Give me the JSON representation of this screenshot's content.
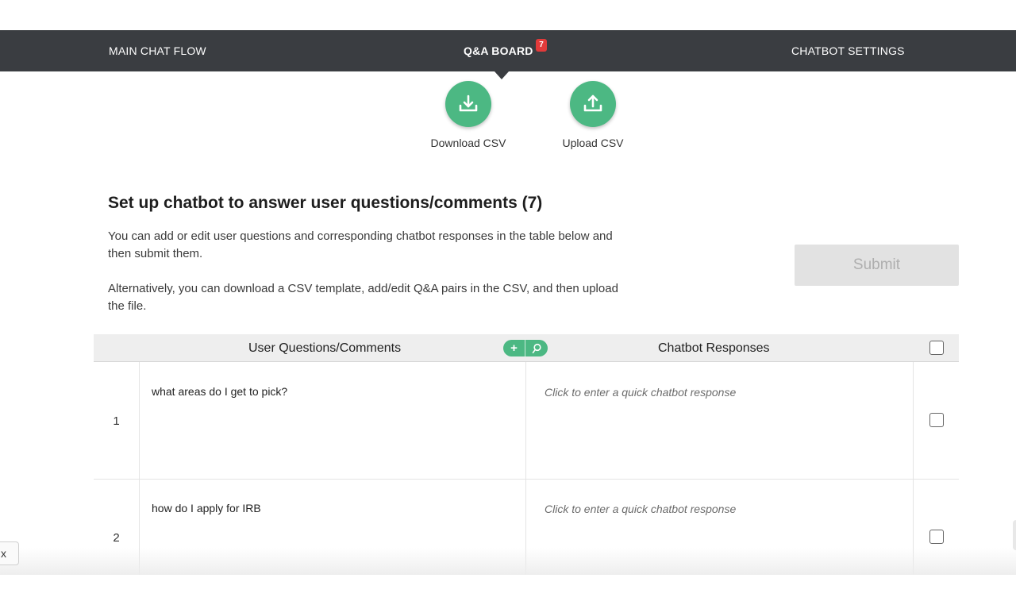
{
  "nav": {
    "main_chat_flow": "MAIN CHAT FLOW",
    "qa_board": "Q&A BOARD",
    "qa_board_badge": "7",
    "chatbot_settings": "CHATBOT SETTINGS",
    "active_tab": "Q&A BOARD"
  },
  "csv": {
    "download_label": "Download CSV",
    "download_icon": "download-icon",
    "upload_label": "Upload CSV",
    "upload_icon": "upload-icon"
  },
  "content": {
    "heading": "Set up chatbot to answer user questions/comments (7)",
    "description_1": "You can add or edit user questions and corresponding chatbot responses in the table below and then submit them.",
    "description_2": "Alternatively, you can download a CSV template, add/edit Q&A pairs in the CSV, and then upload the file.",
    "submit_label": "Submit"
  },
  "table": {
    "headers": {
      "questions": "User Questions/Comments",
      "responses": "Chatbot Responses"
    },
    "tools": {
      "add_icon": "plus-icon",
      "add_glyph": "+",
      "search_icon": "search-icon"
    },
    "rows": [
      {
        "number": "1",
        "question": "what areas do I get to pick?",
        "response_placeholder": "Click to enter a quick chatbot response",
        "checked": false
      },
      {
        "number": "2",
        "question": "how do I apply for IRB",
        "response_placeholder": "Click to enter a quick chatbot response",
        "checked": false
      }
    ]
  },
  "widget": {
    "close_glyph": "x"
  },
  "colors": {
    "nav_bg": "#3a3d41",
    "accent_green": "#4cb883",
    "badge_red": "#e23a3a",
    "submit_disabled_bg": "#e2e2e2"
  }
}
